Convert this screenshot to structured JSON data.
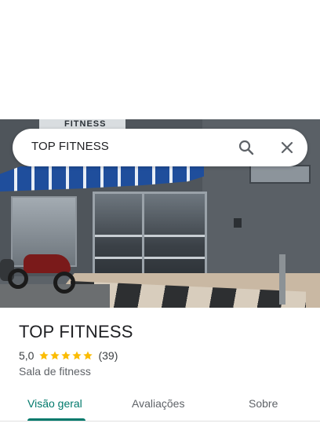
{
  "search": {
    "query": "TOP FITNESS",
    "search_icon": "search-icon",
    "close_icon": "close-icon"
  },
  "photo": {
    "sign_text": "FITNESS"
  },
  "place": {
    "name": "TOP FITNESS",
    "rating": "5,0",
    "stars": 5,
    "star_color": "#fbbc04",
    "review_count": "(39)",
    "category": "Sala de fitness"
  },
  "tabs": [
    {
      "label": "Visão geral",
      "active": true
    },
    {
      "label": "Avaliações",
      "active": false
    },
    {
      "label": "Sobre",
      "active": false
    }
  ],
  "colors": {
    "accent": "#00796b",
    "text_primary": "#202124",
    "text_secondary": "#5f6368"
  }
}
